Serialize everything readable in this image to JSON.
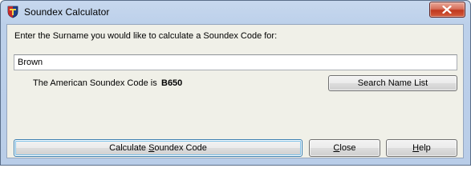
{
  "window": {
    "title": "Soundex Calculator"
  },
  "form": {
    "prompt": "Enter the Surname you would like to calculate a Soundex Code for:",
    "surname_value": "Brown",
    "result_label": "The American Soundex Code is",
    "result_code": "B650"
  },
  "buttons": {
    "search_name_list": "Search Name List",
    "calculate_prefix": "Calculate ",
    "calculate_accel": "S",
    "calculate_suffix": "oundex Code",
    "close_accel": "C",
    "close_rest": "lose",
    "help_accel": "H",
    "help_rest": "elp"
  },
  "icons": {
    "app_icon": "shield-icon",
    "window_close": "close-icon"
  },
  "colors": {
    "titlebar": "#bcd0ea",
    "client_background": "#f0f0e8",
    "close_button": "#c7412a"
  }
}
